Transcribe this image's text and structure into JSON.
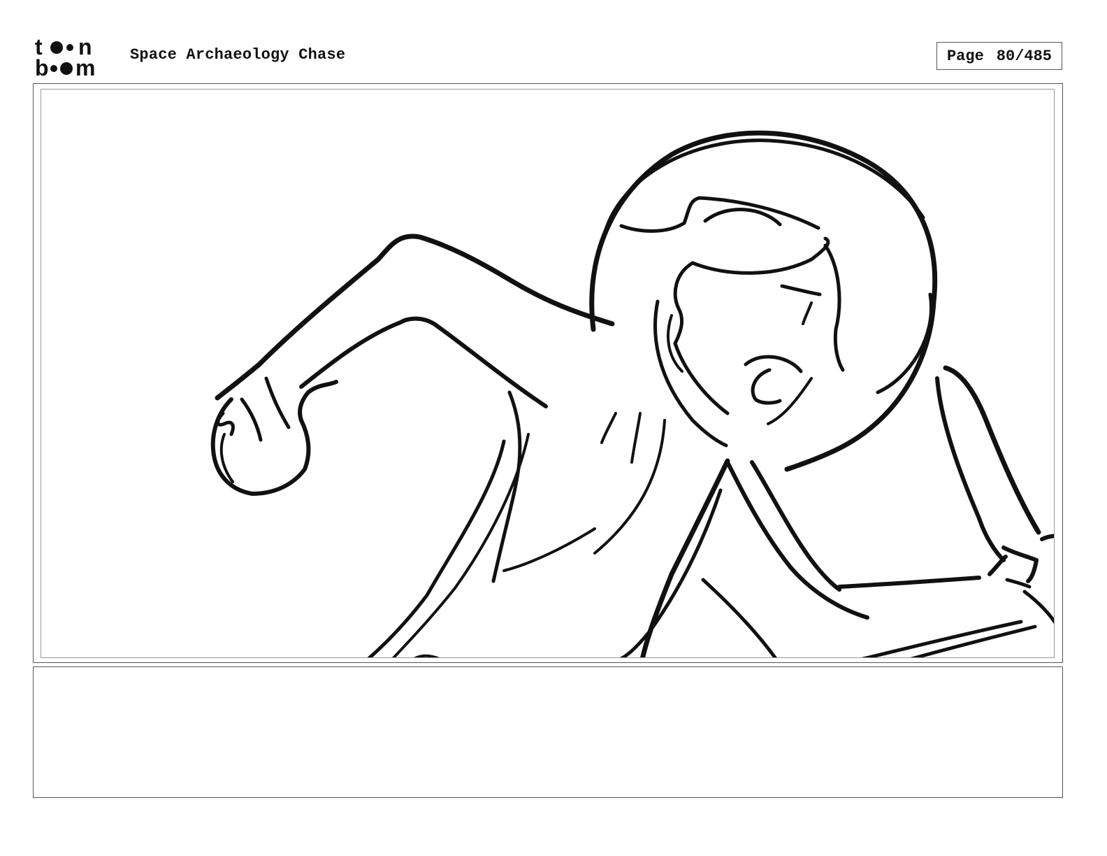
{
  "header": {
    "logo_top": "toon",
    "logo_bottom": "boom",
    "project_title": "Space Archaeology Chase",
    "page_label": "Page",
    "page_number": "80/485"
  },
  "panel": {
    "sketch": "rough storyboard drawing of a character in a space helmet reaching forward with a clenched fist"
  },
  "notes": {
    "text": ""
  },
  "colors": {
    "ink": "#111111",
    "frame": "#555555",
    "background": "#ffffff"
  }
}
